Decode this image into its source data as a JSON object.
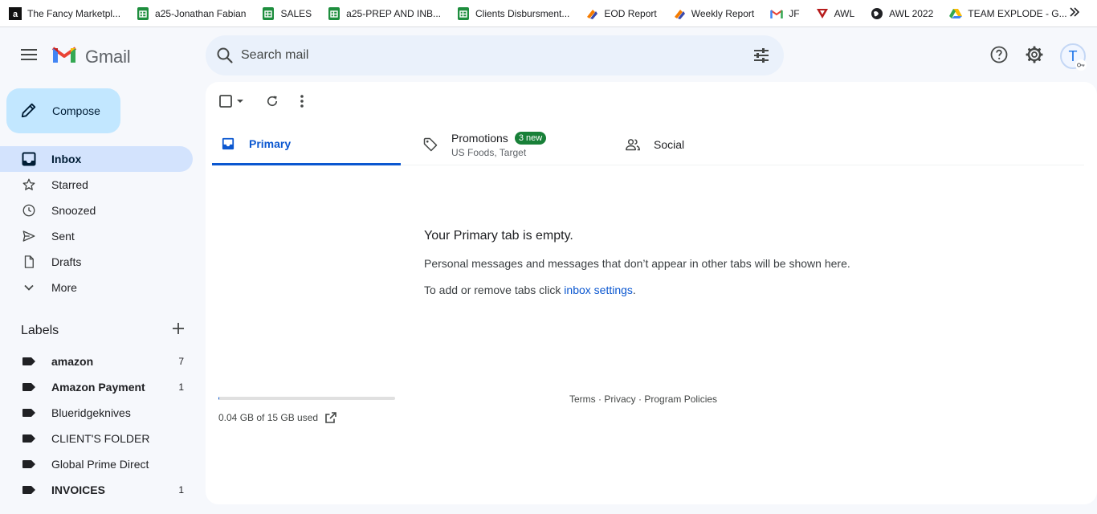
{
  "bookmarks": [
    {
      "label": "The Fancy Marketpl...",
      "icon": "amazon-icon"
    },
    {
      "label": "a25-Jonathan Fabian",
      "icon": "sheets-icon"
    },
    {
      "label": "SALES",
      "icon": "sheets-icon"
    },
    {
      "label": "a25-PREP AND INB...",
      "icon": "sheets-icon"
    },
    {
      "label": "Clients Disbursment...",
      "icon": "sheets-icon"
    },
    {
      "label": "EOD Report",
      "icon": "clickup-icon"
    },
    {
      "label": "Weekly Report",
      "icon": "clickup-icon"
    },
    {
      "label": "JF",
      "icon": "gmail-icon"
    },
    {
      "label": "AWL",
      "icon": "awl-icon"
    },
    {
      "label": "AWL 2022",
      "icon": "globe-icon"
    },
    {
      "label": "TEAM EXPLODE - G...",
      "icon": "drive-icon"
    }
  ],
  "header": {
    "product": "Gmail",
    "search_placeholder": "Search mail",
    "avatar_initial": "T"
  },
  "compose": {
    "label": "Compose"
  },
  "nav": [
    {
      "label": "Inbox",
      "icon": "inbox-icon",
      "active": true
    },
    {
      "label": "Starred",
      "icon": "star-icon"
    },
    {
      "label": "Snoozed",
      "icon": "clock-icon"
    },
    {
      "label": "Sent",
      "icon": "send-icon"
    },
    {
      "label": "Drafts",
      "icon": "draft-icon"
    },
    {
      "label": "More",
      "icon": "chevron-down-icon"
    }
  ],
  "labels": {
    "heading": "Labels",
    "items": [
      {
        "label": "amazon",
        "count": "7",
        "bold": true
      },
      {
        "label": "Amazon Payment",
        "count": "1",
        "bold": true
      },
      {
        "label": "Blueridgeknives",
        "count": "",
        "bold": false
      },
      {
        "label": "CLIENT'S FOLDER",
        "count": "",
        "bold": false
      },
      {
        "label": "Global Prime Direct",
        "count": "",
        "bold": false
      },
      {
        "label": "INVOICES",
        "count": "1",
        "bold": true
      }
    ]
  },
  "tabs": {
    "primary": "Primary",
    "promotions": {
      "label": "Promotions",
      "badge": "3 new",
      "sub": "US Foods, Target"
    },
    "social": "Social"
  },
  "empty": {
    "title": "Your Primary tab is empty.",
    "line1": "Personal messages and messages that don’t appear in other tabs will be shown here.",
    "line2_prefix": "To add or remove tabs click ",
    "line2_link": "inbox settings",
    "line2_suffix": "."
  },
  "storage": {
    "text": "0.04 GB of 15 GB used",
    "fraction": 0.0027
  },
  "footer": {
    "terms": "Terms",
    "privacy": "Privacy",
    "policies": "Program Policies",
    "sep": " · "
  },
  "colors": {
    "accent": "#0b57d0",
    "compose": "#c2e7ff",
    "active_nav": "#d3e3fd",
    "badge": "#188038"
  }
}
